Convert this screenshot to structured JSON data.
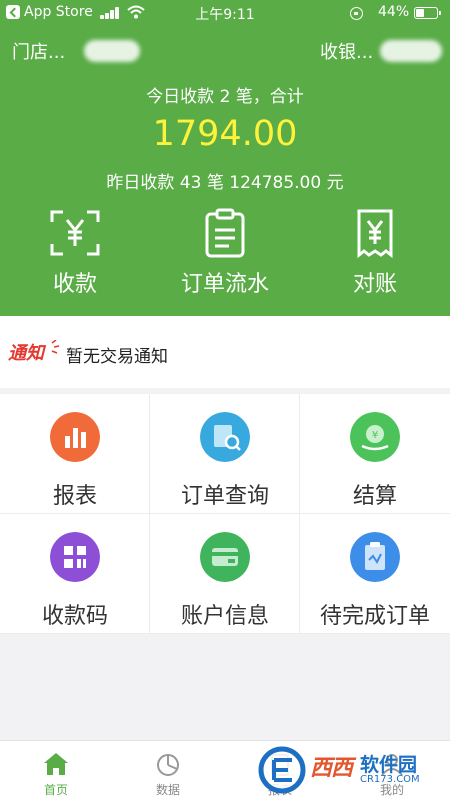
{
  "status_bar": {
    "back_app": "App Store",
    "time": "上午9:11",
    "battery": "44%",
    "battery_level": 0.44
  },
  "header": {
    "store_label": "门店...",
    "cashier_label": "收银...",
    "today_summary": "今日收款 2 笔，合计",
    "today_amount": "1794.00",
    "yesterday_summary": "昨日收款 43 笔 124785.00 元",
    "amount_color": "#fff23a",
    "theme_color": "#5aac47"
  },
  "quick_actions": [
    {
      "label": "收款",
      "icon": "scan-yen-icon"
    },
    {
      "label": "订单流水",
      "icon": "clipboard-icon"
    },
    {
      "label": "对账",
      "icon": "receipt-yen-icon"
    }
  ],
  "notice": {
    "badge": "通知",
    "text": "暂无交易通知"
  },
  "grid": [
    {
      "label": "报表",
      "icon": "report-chart-icon",
      "color": "#f06a3a"
    },
    {
      "label": "订单查询",
      "icon": "order-search-icon",
      "color": "#38a9de"
    },
    {
      "label": "结算",
      "icon": "settlement-icon",
      "color": "#4cc35a"
    },
    {
      "label": "收款码",
      "icon": "qr-grid-icon",
      "color": "#8c4fd6"
    },
    {
      "label": "账户信息",
      "icon": "account-card-icon",
      "color": "#3fb45c"
    },
    {
      "label": "待完成订单",
      "icon": "pending-order-icon",
      "color": "#3d8ee8"
    }
  ],
  "tab_bar": [
    {
      "label": "首页",
      "icon": "home-icon",
      "active": true
    },
    {
      "label": "数据",
      "icon": "pie-chart-icon",
      "active": false
    },
    {
      "label": "报表",
      "icon": "report-tab-icon",
      "active": false
    },
    {
      "label": "我的",
      "icon": "profile-icon",
      "active": false
    }
  ],
  "watermark": {
    "brand": "西西",
    "product": "软件园",
    "url": "CR173.COM"
  }
}
